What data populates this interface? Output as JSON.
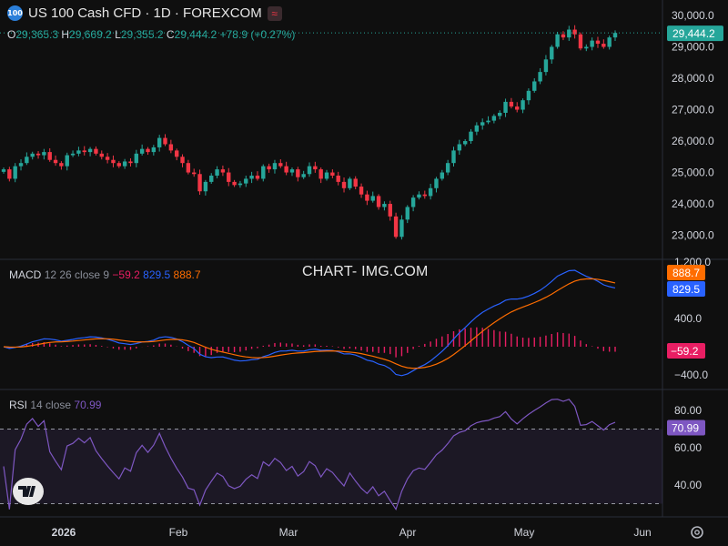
{
  "header": {
    "logo_text": "100",
    "title": "US 100 Cash CFD · 1D · FOREXCOM",
    "badge_icon": "≈"
  },
  "ohlc": {
    "o_label": "O",
    "o_value": "29,365.3",
    "h_label": "H",
    "h_value": "29,669.2",
    "l_label": "L",
    "l_value": "29,355.2",
    "c_label": "C",
    "c_value": "29,444.2",
    "change": "+78.9 (+0.27%)"
  },
  "watermark": "CHART- IMG.COM",
  "macd_legend": {
    "name": "MACD",
    "params": "12 26 close 9",
    "hist": "−59.2",
    "macd": "829.5",
    "signal": "888.7"
  },
  "rsi_legend": {
    "name": "RSI",
    "params": "14 close",
    "value": "70.99"
  },
  "colors": {
    "up": "#26a69a",
    "down": "#f23645",
    "macd": "#2962ff",
    "signal": "#ff6d00",
    "hist": "#e91e63",
    "rsi": "#7e57c2"
  },
  "chart_data": [
    {
      "type": "candlestick",
      "title": "US 100 Cash CFD · 1D · FOREXCOM",
      "x_ticks": [
        "2026",
        "Feb",
        "Mar",
        "Apr",
        "May",
        "Jun"
      ],
      "y_ticks": [
        "30,000.0",
        "29,000.0",
        "28,000.0",
        "27,000.0",
        "26,000.0",
        "25,000.0",
        "24,000.0",
        "23,000.0"
      ],
      "ylim": [
        22600,
        30200
      ],
      "last_price": "29,444.2",
      "close": [
        25100,
        24800,
        25200,
        25300,
        25500,
        25600,
        25550,
        25650,
        25400,
        25300,
        25200,
        25550,
        25600,
        25700,
        25650,
        25750,
        25600,
        25500,
        25400,
        25300,
        25200,
        25350,
        25300,
        25600,
        25750,
        25650,
        25800,
        26100,
        25900,
        25700,
        25500,
        25300,
        25000,
        24950,
        24400,
        24700,
        24900,
        25100,
        25000,
        24700,
        24600,
        24650,
        24800,
        24900,
        24800,
        25200,
        25100,
        25300,
        25200,
        25000,
        25100,
        24850,
        24950,
        25200,
        25100,
        24800,
        25000,
        24900,
        24700,
        24500,
        24800,
        24550,
        24300,
        24100,
        24250,
        23900,
        24000,
        23600,
        22950,
        23500,
        23900,
        24200,
        24300,
        24250,
        24500,
        24800,
        25000,
        25300,
        25700,
        25900,
        26000,
        26300,
        26500,
        26600,
        26650,
        26800,
        26900,
        27250,
        27100,
        27000,
        27300,
        27600,
        27900,
        28200,
        28600,
        29000,
        29400,
        29300,
        29550,
        29400,
        28950,
        29000,
        29200,
        29100,
        29000,
        29300,
        29444
      ]
    },
    {
      "type": "line",
      "title": "MACD",
      "series": [
        {
          "name": "MACD",
          "last": 829.5
        },
        {
          "name": "Signal",
          "last": 888.7
        },
        {
          "name": "Histogram",
          "last": -59.2
        }
      ],
      "y_ticks": [
        "1,200.0",
        "400.0",
        "−400.0"
      ]
    },
    {
      "type": "line",
      "title": "RSI",
      "series": [
        {
          "name": "RSI",
          "last": 70.99
        }
      ],
      "y_ticks": [
        "80.00",
        "60.00",
        "40.00"
      ],
      "bands": [
        70,
        30
      ]
    }
  ]
}
